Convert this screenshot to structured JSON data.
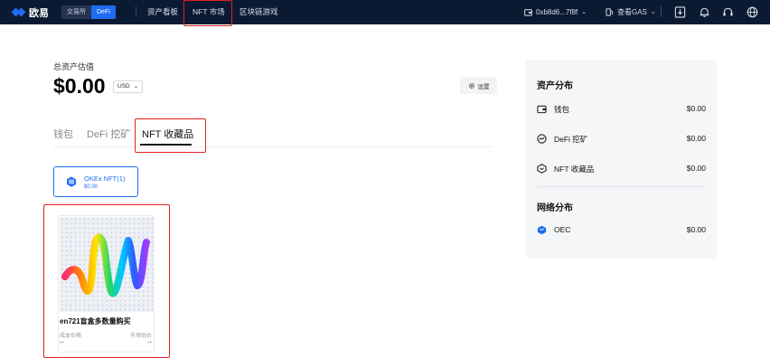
{
  "header": {
    "brand": "欧易",
    "mode_tabs": [
      "交易所",
      "DeFi"
    ],
    "active_mode": "DeFi",
    "nav": [
      "资产看板",
      "NFT 市场",
      "区块链游戏"
    ],
    "wallet_address": "0xb8d6...7f8f",
    "gas_label": "查看GAS",
    "icons": [
      "wallet-icon",
      "download-icon",
      "bell-icon",
      "headset-icon",
      "settings-icon",
      "globe-icon"
    ]
  },
  "summary": {
    "title": "总资产估值",
    "value": "$0.00",
    "currency": "USD",
    "settings_label": "设置"
  },
  "tabs": [
    "钱包",
    "DeFi 挖矿",
    "NFT 收藏品"
  ],
  "active_tab": "NFT 收藏品",
  "filter": {
    "name": "OKEx NFT(1)",
    "value": "$0.00"
  },
  "nft_card": {
    "title": "en721盲盒多数量购买",
    "cost_label": "成本价格",
    "market_label": "市场估价",
    "cost_value": "--",
    "market_value": "--"
  },
  "asset_distribution": {
    "title": "资产分布",
    "items": [
      {
        "label": "钱包",
        "value": "$0.00",
        "icon": "wallet-icon"
      },
      {
        "label": "DeFi 挖矿",
        "value": "$0.00",
        "icon": "chart-icon"
      },
      {
        "label": "NFT 收藏品",
        "value": "$0.00",
        "icon": "nft-icon"
      }
    ]
  },
  "network_distribution": {
    "title": "网络分布",
    "items": [
      {
        "label": "OEC",
        "value": "$0.00",
        "icon": "oec-icon"
      }
    ]
  },
  "colors": {
    "nav_bg": "#0b1a33",
    "accent": "#1d6cf2",
    "highlight": "#e02020"
  }
}
